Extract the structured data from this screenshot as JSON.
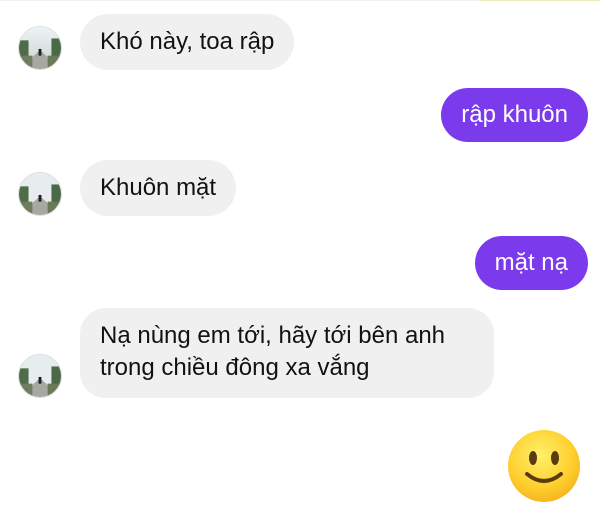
{
  "chat": {
    "messages": [
      {
        "direction": "incoming",
        "text": "Khó này, toa rập"
      },
      {
        "direction": "outgoing",
        "text": "rập khuôn"
      },
      {
        "direction": "incoming",
        "text": "Khuôn mặt"
      },
      {
        "direction": "outgoing",
        "text": "mặt nạ"
      },
      {
        "direction": "incoming",
        "lines": [
          "Nạ nùng em tới, hãy tới bên anh",
          "trong chiều đông xa vắng"
        ]
      },
      {
        "direction": "outgoing",
        "emoji": "🙂",
        "icon": "slightly-smiling-face-icon"
      }
    ]
  },
  "colors": {
    "outgoing_bubble": "#7c3aed",
    "incoming_bubble": "#f0f0f0",
    "incoming_text": "#121212",
    "outgoing_text": "#ffffff"
  },
  "avatar": {
    "icon": "contact-avatar-icon"
  }
}
